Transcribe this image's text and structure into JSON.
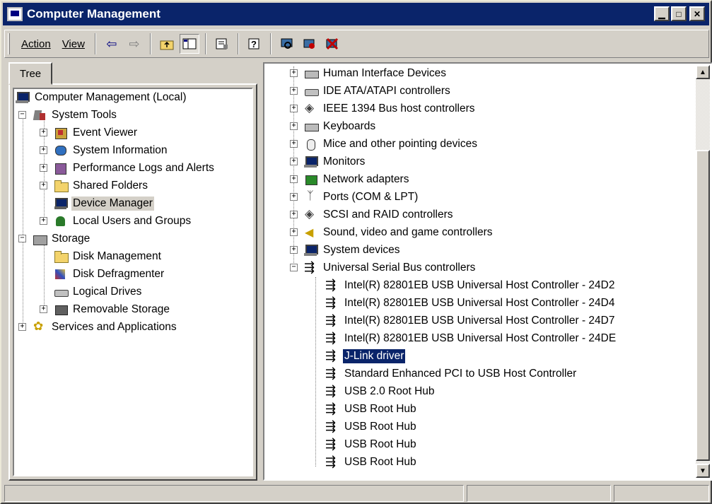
{
  "window": {
    "title": "Computer Management"
  },
  "menu": {
    "action": "Action",
    "view": "View"
  },
  "toolbar_icons": [
    "back-arrow-icon",
    "forward-arrow-icon",
    "up-folder-icon",
    "show-tree-icon",
    "properties-icon",
    "help-icon",
    "scan-hardware-icon",
    "disable-device-icon",
    "uninstall-device-icon"
  ],
  "tab": {
    "label": "Tree"
  },
  "tree": {
    "root": "Computer Management (Local)",
    "system_tools": "System Tools",
    "event_viewer": "Event Viewer",
    "system_information": "System Information",
    "performance_logs": "Performance Logs and Alerts",
    "shared_folders": "Shared Folders",
    "device_manager": "Device Manager",
    "local_users": "Local Users and Groups",
    "storage": "Storage",
    "disk_management": "Disk Management",
    "disk_defragmenter": "Disk Defragmenter",
    "logical_drives": "Logical Drives",
    "removable_storage": "Removable Storage",
    "services_apps": "Services and Applications"
  },
  "devices": {
    "categories": [
      "Human Interface Devices",
      "IDE ATA/ATAPI controllers",
      "IEEE 1394 Bus host controllers",
      "Keyboards",
      "Mice and other pointing devices",
      "Monitors",
      "Network adapters",
      "Ports (COM & LPT)",
      "SCSI and RAID controllers",
      "Sound, video and game controllers",
      "System devices",
      "Universal Serial Bus controllers"
    ],
    "usb_children": [
      "Intel(R) 82801EB USB Universal Host Controller - 24D2",
      "Intel(R) 82801EB USB Universal Host Controller - 24D4",
      "Intel(R) 82801EB USB Universal Host Controller - 24D7",
      "Intel(R) 82801EB USB Universal Host Controller - 24DE",
      "J-Link driver",
      "Standard Enhanced PCI to USB Host Controller",
      "USB 2.0 Root Hub",
      "USB Root Hub",
      "USB Root Hub",
      "USB Root Hub",
      "USB Root Hub"
    ]
  },
  "colors": {
    "titlebar": "#0a246a",
    "selection": "#0a246a",
    "face": "#d4d0c8"
  }
}
